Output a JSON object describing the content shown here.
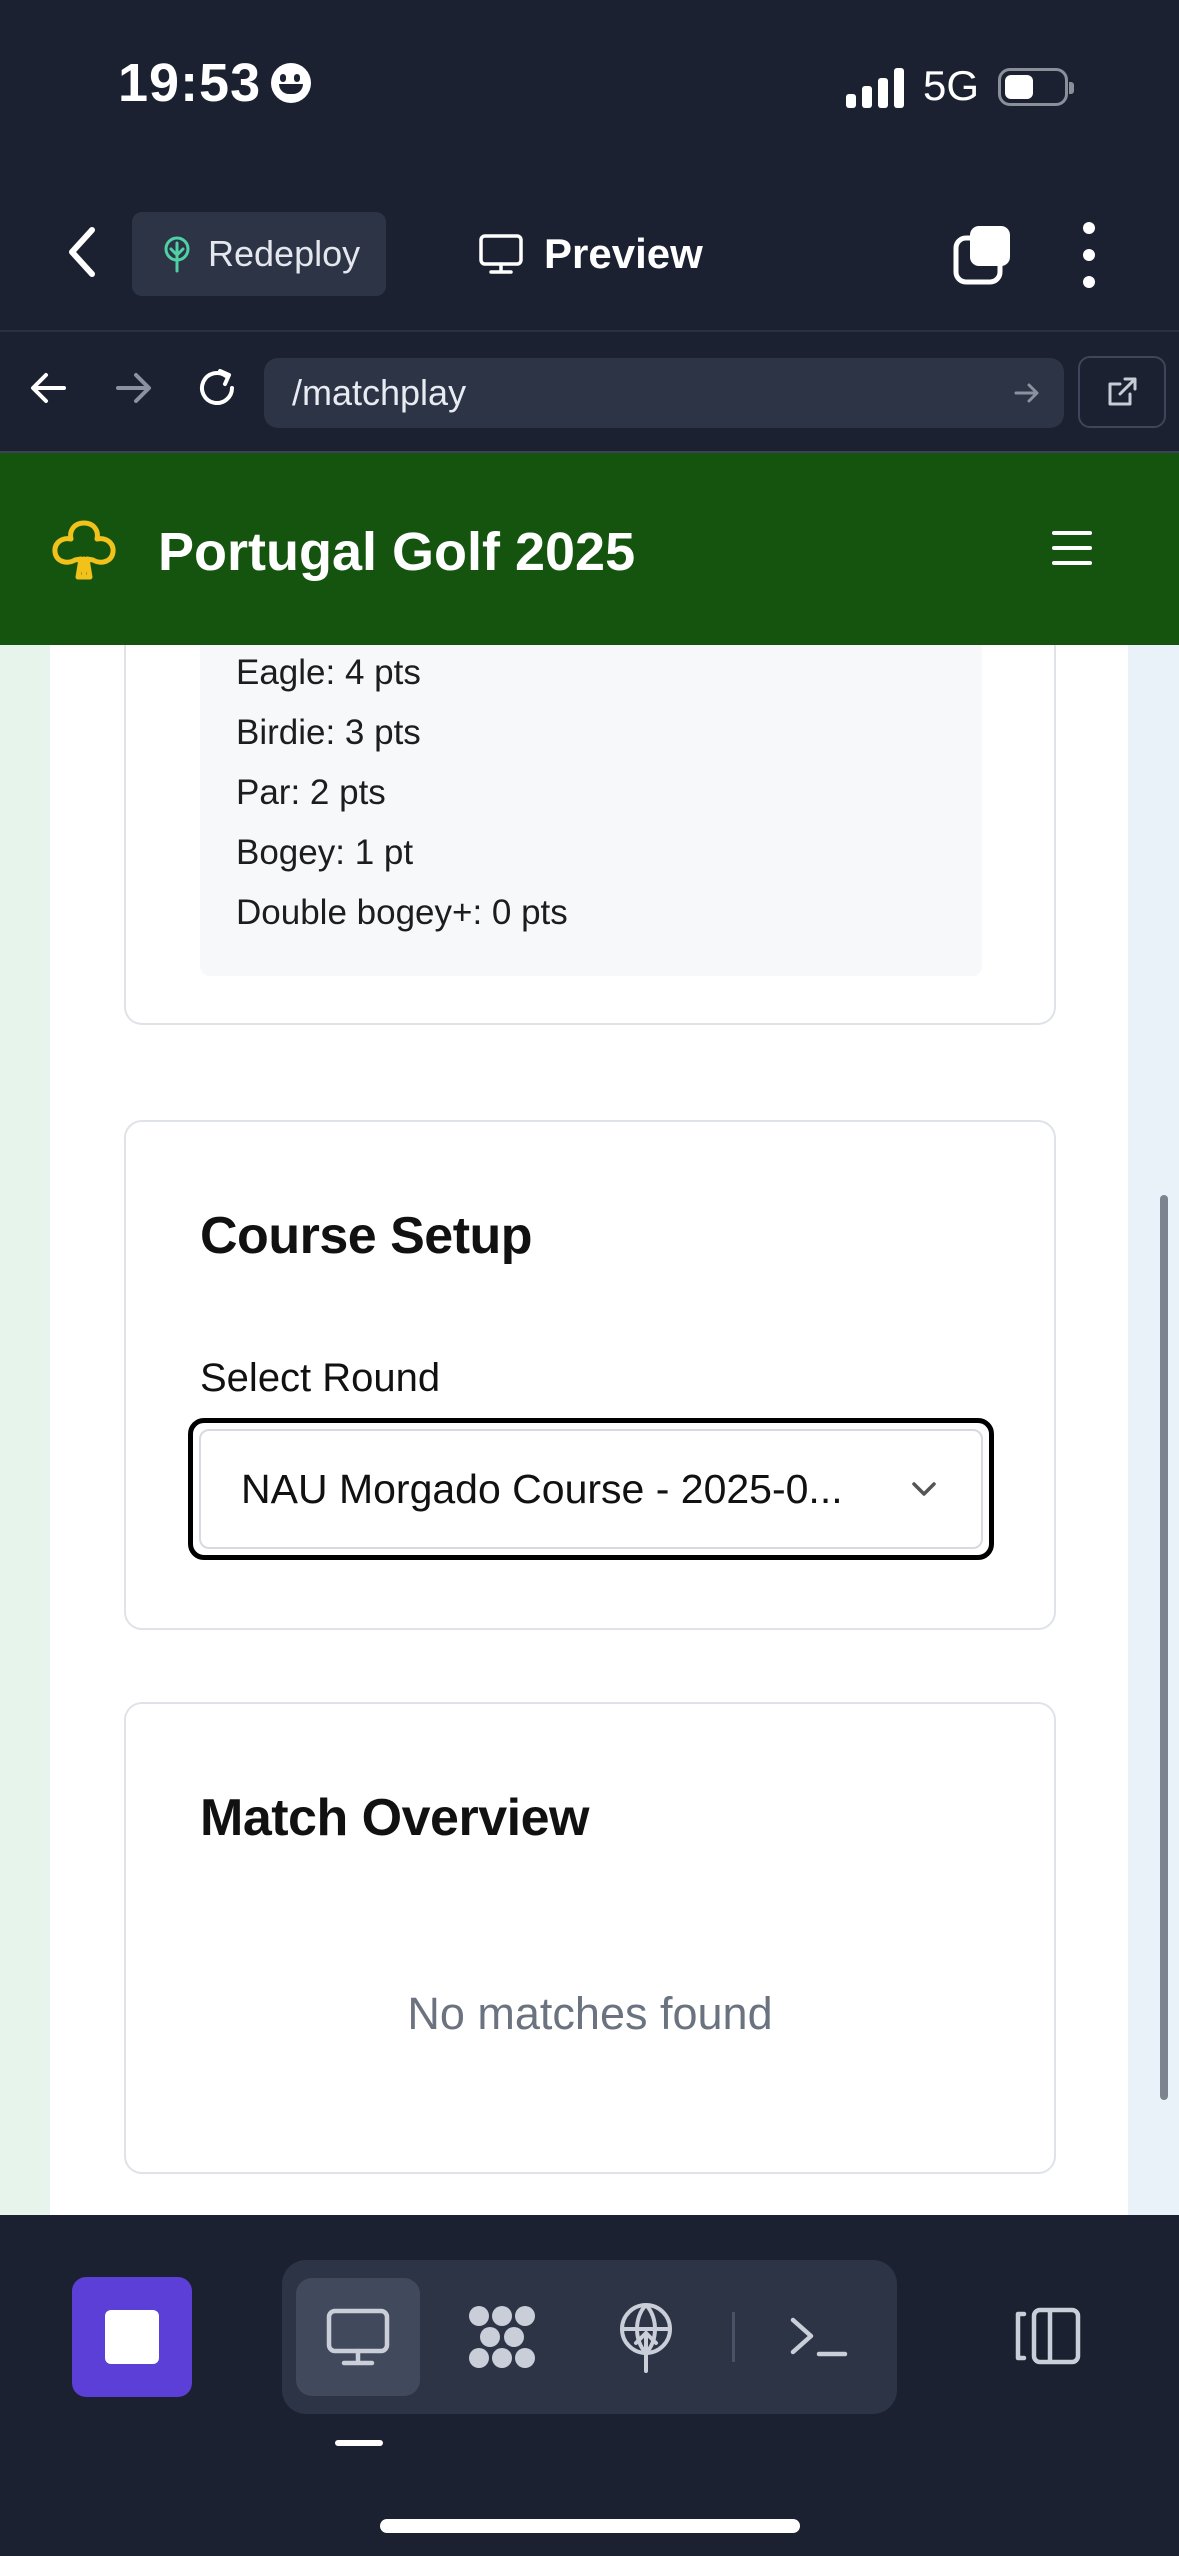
{
  "status_bar": {
    "time": "19:53",
    "network": "5G"
  },
  "toolbar": {
    "redeploy_label": "Redeploy",
    "preview_label": "Preview"
  },
  "browser": {
    "url": "/matchplay"
  },
  "site": {
    "title": "Portugal Golf 2025"
  },
  "scoring": {
    "lines": [
      "Eagle: 4 pts",
      "Birdie: 3 pts",
      "Par: 2 pts",
      "Bogey: 1 pt",
      "Double bogey+: 0 pts"
    ]
  },
  "course_setup": {
    "heading": "Course Setup",
    "select_label": "Select Round",
    "selected_round": "NAU Morgado Course - 2025-0..."
  },
  "match_overview": {
    "heading": "Match Overview",
    "empty_message": "No matches found"
  },
  "colors": {
    "header_green": "#14540f",
    "club_icon": "#f2c21b",
    "stop_button": "#5b3fd6",
    "chrome_dark": "#1b2131"
  },
  "icons": [
    "back-chevron-icon",
    "tree-icon",
    "monitor-icon",
    "tabs-icon",
    "more-vertical-icon",
    "arrow-left-icon",
    "arrow-right-icon",
    "refresh-icon",
    "external-link-icon",
    "club-icon",
    "hamburger-icon",
    "chevron-down-icon",
    "stop-icon",
    "cluster-icon",
    "globe-upload-icon",
    "terminal-icon",
    "side-panel-icon"
  ]
}
